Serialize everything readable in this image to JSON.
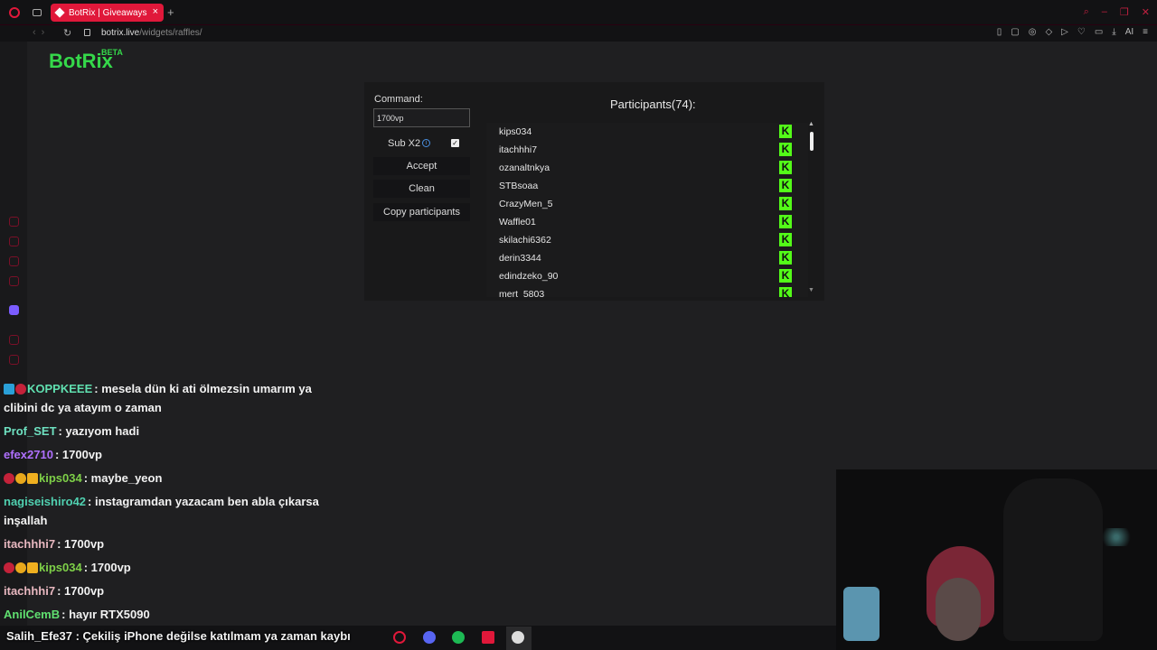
{
  "browser": {
    "tab_title": "BotRix | Giveaways",
    "tab_close": "×",
    "new_tab": "+",
    "url_host": "botrix.live",
    "url_path": "/widgets/raffles/",
    "ai_label": "AI",
    "window_controls": [
      "⌕",
      "–",
      "❐",
      "✕"
    ]
  },
  "brand": {
    "name": "BotRix",
    "tag": "BETA",
    "color": "#35d84a"
  },
  "raffle": {
    "command_label": "Command:",
    "command_value": "1700vp",
    "sub_label": "Sub X2",
    "sub_checked": true,
    "accept_label": "Accept",
    "clean_label": "Clean",
    "copy_label": "Copy participants",
    "participants_title": "Participants(74):",
    "participants": [
      "kips034",
      "itachhhi7",
      "ozanaltnkya",
      "STBsoaa",
      "CrazyMen_5",
      "Waffle01",
      "skilachi6362",
      "derin3344",
      "edindzeko_90",
      "mert_5803"
    ],
    "kick_icon": "K",
    "kick_color": "#53fc18"
  },
  "chat": {
    "messages": [
      {
        "user": "KOPPKEEE",
        "color": "#60e0b0",
        "text": ": mesela dün ki ati ölmezsin umarım ya clibini dc ya atayım o zaman",
        "badges": [
          "blue",
          "red"
        ]
      },
      {
        "user": "Prof_SET",
        "color": "#6ee0c0",
        "text": ": yazıyom hadi",
        "badges": []
      },
      {
        "user": "efex2710",
        "color": "#b070ff",
        "text": ": 1700vp",
        "badges": []
      },
      {
        "user": "kips034",
        "color": "#7ed048",
        "text": ": maybe_yeon",
        "badges": [
          "red",
          "gold",
          "crown"
        ]
      },
      {
        "user": "nagiseishiro42",
        "color": "#50d0b0",
        "text": ": instagramdan yazacam ben abla çıkarsa inşallah",
        "badges": []
      },
      {
        "user": "itachhhi7",
        "color": "#e8b8c0",
        "text": ": 1700vp",
        "badges": []
      },
      {
        "user": "kips034",
        "color": "#7ed048",
        "text": ": 1700vp",
        "badges": [
          "red",
          "gold",
          "crown"
        ]
      },
      {
        "user": "itachhhi7",
        "color": "#e8b8c0",
        "text": ": 1700vp",
        "badges": []
      },
      {
        "user": "AnilCemB",
        "color": "#60e070",
        "text": ": hayır RTX5090",
        "badges": []
      }
    ],
    "partial_message": "Salih_Efe37 : Çekiliş iPhone değilse katılmam ya zaman kaybı"
  }
}
